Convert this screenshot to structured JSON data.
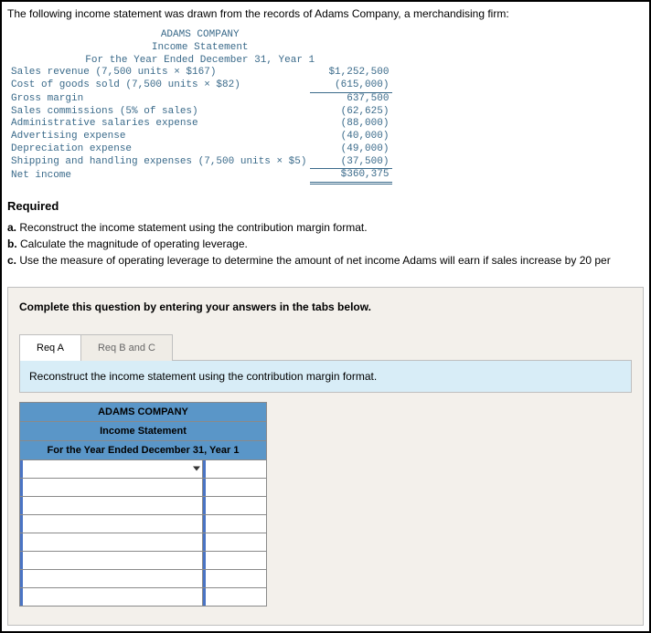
{
  "intro": "The following income statement was drawn from the records of Adams Company, a merchandising firm:",
  "statement": {
    "company": "ADAMS COMPANY",
    "title": "Income Statement",
    "period": "For the Year Ended December 31, Year 1",
    "lines": [
      {
        "label": "Sales revenue (7,500 units × $167)",
        "amount": "$1,252,500",
        "underline": ""
      },
      {
        "label": "Cost of goods sold (7,500 units × $82)",
        "amount": "(615,000)",
        "underline": "single"
      },
      {
        "label": "Gross margin",
        "amount": "637,500",
        "underline": ""
      },
      {
        "label": "Sales commissions (5% of sales)",
        "amount": "(62,625)",
        "underline": ""
      },
      {
        "label": "Administrative salaries expense",
        "amount": "(88,000)",
        "underline": ""
      },
      {
        "label": "Advertising expense",
        "amount": "(40,000)",
        "underline": ""
      },
      {
        "label": "Depreciation expense",
        "amount": "(49,000)",
        "underline": ""
      },
      {
        "label": "Shipping and handling expenses (7,500 units × $5)",
        "amount": "(37,500)",
        "underline": "single"
      },
      {
        "label": "Net income",
        "amount": "$360,375",
        "underline": "double"
      }
    ]
  },
  "required": {
    "heading": "Required",
    "a": "Reconstruct the income statement using the contribution margin format.",
    "b": "Calculate the magnitude of operating leverage.",
    "c": "Use the measure of operating leverage to determine the amount of net income Adams will earn if sales increase by 20 per"
  },
  "answerArea": {
    "prompt": "Complete this question by entering your answers in the tabs below.",
    "tabs": {
      "a": "Req A",
      "bc": "Req B and C"
    },
    "instruction": "Reconstruct the income statement using the contribution margin format.",
    "entryHeader": {
      "company": "ADAMS COMPANY",
      "title": "Income Statement",
      "period": "For the Year Ended December 31, Year 1"
    },
    "rowCount": 8
  }
}
